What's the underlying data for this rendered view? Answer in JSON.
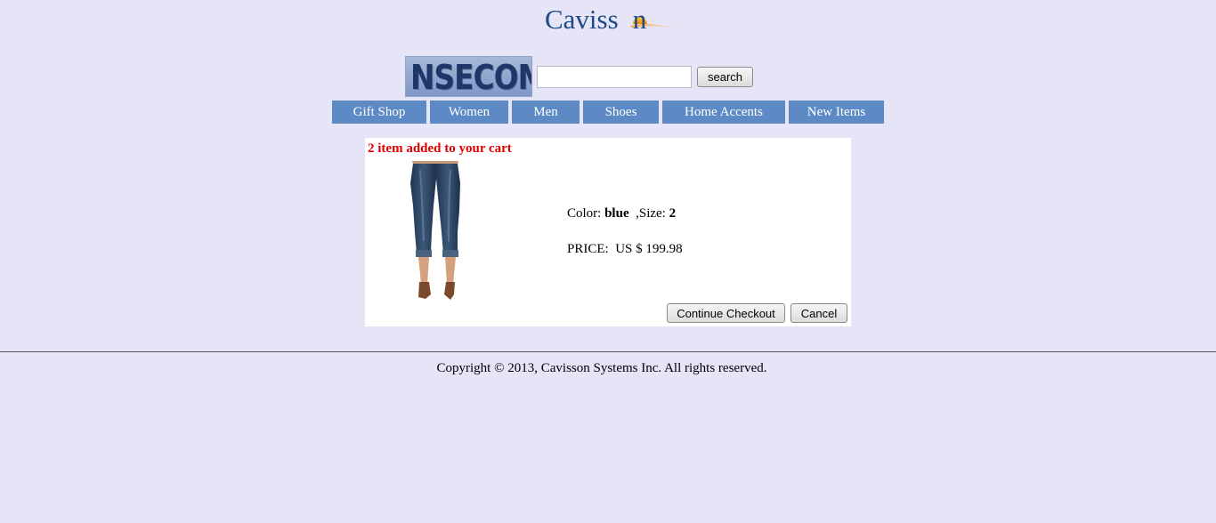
{
  "logo": {
    "text": "Cavisson"
  },
  "banner": {
    "text": "NSECOM"
  },
  "search": {
    "value": "",
    "placeholder": "",
    "button_label": "search"
  },
  "nav": {
    "items": [
      {
        "label": "Gift Shop"
      },
      {
        "label": "Women"
      },
      {
        "label": "Men"
      },
      {
        "label": "Shoes"
      },
      {
        "label": "Home Accents"
      },
      {
        "label": "New Items"
      }
    ]
  },
  "cart": {
    "message": "2 item added to your cart",
    "color_label": "Color:",
    "color_value": "blue",
    "size_label": ",Size:",
    "size_value": "2",
    "price_label": "PRICE:",
    "price_value": "US $ 199.98",
    "continue_label": "Continue Checkout",
    "cancel_label": "Cancel"
  },
  "footer": {
    "copyright": "Copyright © 2013, Cavisson Systems Inc. All rights reserved."
  },
  "colors": {
    "background": "#e5e5f7",
    "nav_bg": "#5d8ac5",
    "message_red": "#e00000",
    "logo_blue": "#1d4a86"
  },
  "icons": {
    "logo_sun": "sun-logo-icon",
    "product": "capri-jeans-image"
  }
}
